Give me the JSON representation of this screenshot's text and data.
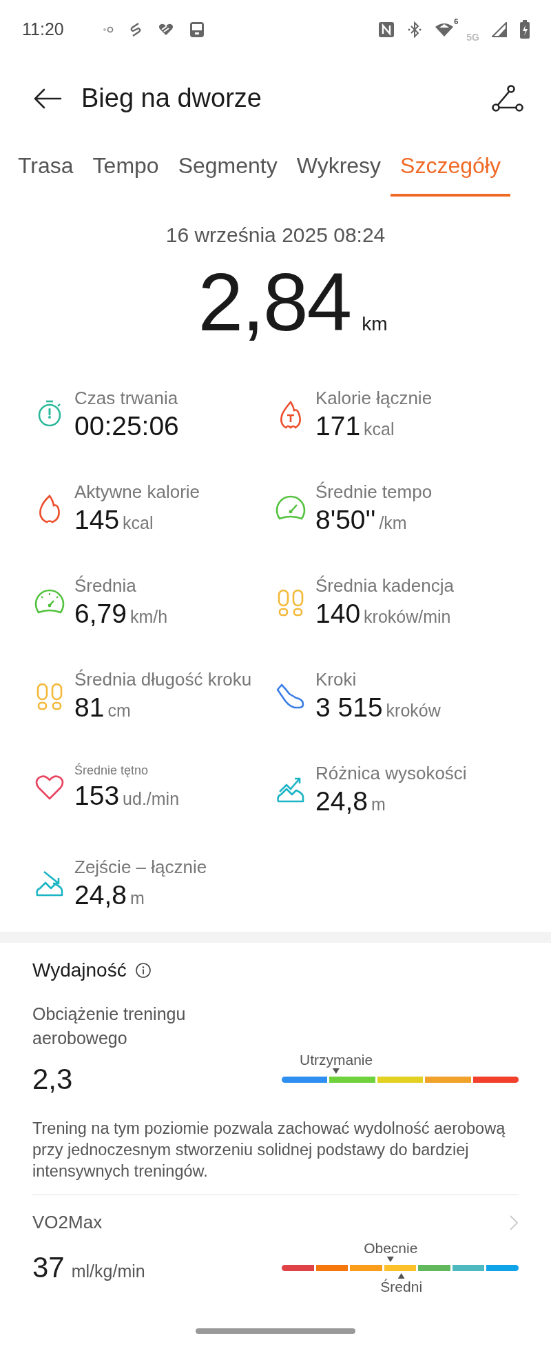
{
  "status_bar": {
    "time": "11:20",
    "wifi_badge": "6",
    "network": "5G"
  },
  "header": {
    "title": "Bieg na dworze"
  },
  "tabs": [
    {
      "label": "Trasa",
      "selected": false
    },
    {
      "label": "Tempo",
      "selected": false
    },
    {
      "label": "Segmenty",
      "selected": false
    },
    {
      "label": "Wykresy",
      "selected": false
    },
    {
      "label": "Szczegóły",
      "selected": true
    }
  ],
  "summary": {
    "date": "16 września 2025 08:24",
    "distance": "2,84",
    "unit": "km"
  },
  "stats": [
    {
      "kind": "standard",
      "label": "Czas trwania",
      "value": "00:25:06"
    },
    {
      "kind": "standard",
      "label": "Kalorie łącznie",
      "value": "171",
      "unit": "kcal"
    },
    {
      "kind": "standard",
      "label": "Aktywne kalorie",
      "value": "145",
      "unit": "kcal"
    },
    {
      "kind": "standard",
      "label": "Średnie tempo",
      "value": "8'50''",
      "unit": "/km"
    },
    {
      "kind": "standard",
      "label": "Średnia",
      "value": "6,79",
      "unit": "km/h"
    },
    {
      "kind": "standard",
      "label": "Średnia kadencja",
      "value": "140",
      "unit": "kroków/min"
    },
    {
      "kind": "standard",
      "label": "Średnia długość kroku",
      "value": "81",
      "unit": "cm"
    },
    {
      "kind": "standard",
      "label": "Kroki",
      "value": "3 515",
      "unit": "kroków"
    },
    {
      "kind": "small-label",
      "label": "Średnie tętno",
      "value": "153",
      "unit": "ud./min"
    },
    {
      "kind": "standard",
      "label": "Różnica wysokości",
      "value": "24,8",
      "unit": "m"
    },
    {
      "kind": "standard",
      "label": "Zejście – łącznie",
      "value": "24,8",
      "unit": "m"
    }
  ],
  "performance": {
    "title": "Wydajność",
    "training_load": {
      "label": "Obciążenie treningu aerobowego",
      "value": "2,3",
      "scale": {
        "segments": [
          {
            "color": "#2f8ff0"
          },
          {
            "color": "#6fd23c"
          },
          {
            "color": "#e2d022"
          },
          {
            "color": "#f0a22a"
          },
          {
            "color": "#f2402c"
          }
        ],
        "markers": [
          {
            "label": "Utrzymanie"
          }
        ]
      },
      "description": "Trening na tym poziomie pozwala zachować wydolność aerobową przy jednoczesnym stworzeniu solidnej podstawy do bardziej intensywnych treningów."
    },
    "vo2max": {
      "label": "VO2Max",
      "value": "37",
      "unit": "ml/kg/min",
      "scale": {
        "segments": [
          {
            "color": "#df4348"
          },
          {
            "color": "#f6780d"
          },
          {
            "color": "#fa9d1b"
          },
          {
            "color": "#fbc02a"
          },
          {
            "color": "#62b85c"
          },
          {
            "color": "#4fb9c0"
          },
          {
            "color": "#0fa3ea"
          }
        ],
        "markers": [
          {
            "label": "Obecnie"
          },
          {
            "label": "Średni"
          }
        ]
      }
    }
  }
}
